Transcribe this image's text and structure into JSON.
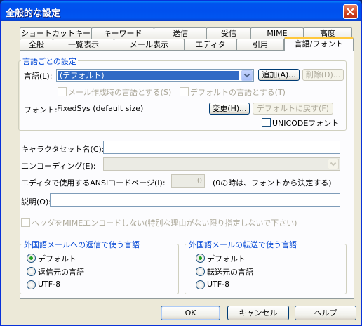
{
  "window": {
    "title": "全般的な設定"
  },
  "tabs_row1": [
    {
      "label": "ショートカットキー"
    },
    {
      "label": "キーワード"
    },
    {
      "label": "送信"
    },
    {
      "label": "受信"
    },
    {
      "label": "MIME"
    },
    {
      "label": "高度"
    }
  ],
  "tabs_row2": [
    {
      "label": "全般"
    },
    {
      "label": "一覧表示"
    },
    {
      "label": "メール表示"
    },
    {
      "label": "エディタ"
    },
    {
      "label": "引用"
    },
    {
      "label": "言語/フォント",
      "active": true
    }
  ],
  "lang_group": {
    "title": "言語ごとの設定",
    "language_label": "言語(L):",
    "language_value": "(デフォルト)",
    "add_button": "追加(A)...",
    "delete_button": "削除(D)...",
    "mail_lang_check": "メール作成時の言語とする(S)",
    "default_lang_check": "デフォルトの言語とする(T)",
    "font_label": "フォント:",
    "font_value": "FixedSys (default size)",
    "change_button": "変更(H)...",
    "reset_button": "デフォルトに戻す(F)",
    "unicode_font_check": "UNICODEフォント"
  },
  "fields": {
    "charset_label": "キャラクタセット名(C):",
    "charset_value": "",
    "encoding_label": "エンコーディング(E):",
    "encoding_value": "",
    "ansi_label": "エディタで使用するANSIコードページ(I):",
    "ansi_value": "0",
    "ansi_note": "(0の時は、フォントから決定する)",
    "description_label": "説明(O):",
    "description_value": "",
    "mime_header_check": "ヘッダをMIMEエンコードしない(特別な理由がない限り指定しないで下さい)"
  },
  "reply_group": {
    "title": "外国語メールへの返信で使う言語",
    "options": [
      "デフォルト",
      "返信元の言語",
      "UTF-8"
    ],
    "selected": 0
  },
  "forward_group": {
    "title": "外国語メールの転送で使う言語",
    "options": [
      "デフォルト",
      "転送元の言語",
      "UTF-8"
    ],
    "selected": 0
  },
  "buttons": {
    "ok": "OK",
    "cancel": "キャンセル",
    "help": "ヘルプ"
  },
  "colors": {
    "title_bar": "#0054e3",
    "group_title": "#0046d5",
    "radio_dot": "#21a121"
  }
}
